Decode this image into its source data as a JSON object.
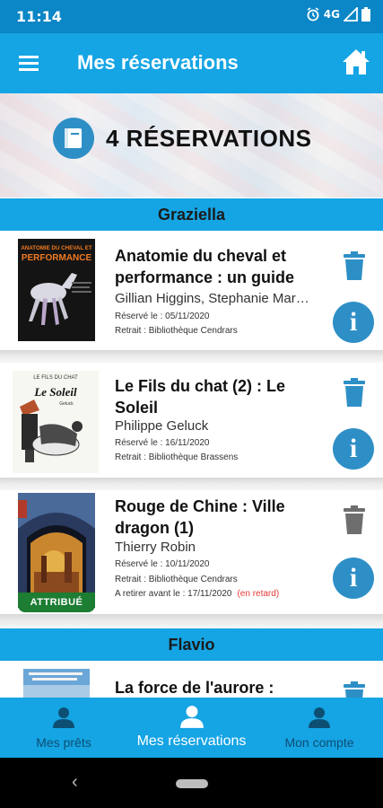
{
  "status_bar": {
    "time": "11:14",
    "network": "4G"
  },
  "app_bar": {
    "title": "Mes réservations"
  },
  "summary": {
    "text": "4 RÉSERVATIONS"
  },
  "sections": [
    {
      "name": "Graziella",
      "items": [
        {
          "title": "Anatomie du cheval et performance : un guide",
          "author": "Gillian Higgins, Stephanie Mar…",
          "reserved": "Réservé le : 05/11/2020",
          "pickup": "Retrait : Bibliothèque Cendrars"
        },
        {
          "title": "Le Fils du chat (2) : Le Soleil",
          "author": "Philippe Geluck",
          "reserved": "Réservé le : 16/11/2020",
          "pickup": "Retrait : Bibliothèque Brassens"
        },
        {
          "title": "Rouge de Chine : Ville dragon (1)",
          "author": "Thierry Robin",
          "reserved": "Réservé le : 10/11/2020",
          "pickup": "Retrait : Bibliothèque Cendrars",
          "deadline": "A retirer avant le : 17/11/2020",
          "late": "(en retard)",
          "badge": "ATTRIBUÉ"
        }
      ]
    },
    {
      "name": "Flavio",
      "items": [
        {
          "title": "La force de l'aurore :"
        }
      ]
    }
  ],
  "covers": {
    "anatomie": {
      "line1": "ANATOMIE DU CHEVAL ET",
      "line2": "PERFORMANCE"
    },
    "fils_du_chat": {
      "line1": "LE FILS DU CHAT",
      "line2": "Le Soleil",
      "line3": "Geluck"
    }
  },
  "bottom_nav": {
    "loans": "Mes prêts",
    "reservations": "Mes réservations",
    "account": "Mon compte"
  },
  "colors": {
    "primary": "#15a4e4",
    "status_bar": "#0b86c6",
    "action_blue": "#2e8fc6",
    "attributed_green": "#1c7d33",
    "late_red": "#e53935"
  },
  "icons": {
    "menu": "menu-icon",
    "home": "home-icon",
    "book": "book-icon",
    "delete": "trash-icon",
    "info": "info-icon",
    "person": "person-icon"
  }
}
